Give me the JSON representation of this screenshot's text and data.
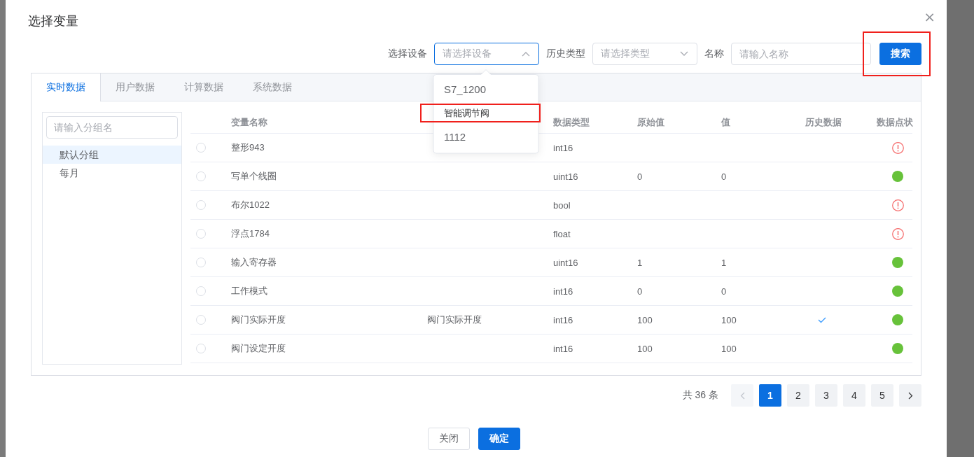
{
  "dialog": {
    "title": "选择变量",
    "close": "×"
  },
  "filters": {
    "device_label": "选择设备",
    "device_select": {
      "placeholder": "请选择设备",
      "expanded": true
    },
    "history_label": "历史类型",
    "history_select": {
      "placeholder": "请选择类型",
      "expanded": false
    },
    "name_label": "名称",
    "name_field": {
      "placeholder": "请输入名称"
    },
    "search_button": {
      "label": "搜索",
      "highlighted": true
    }
  },
  "device_dropdown": {
    "options": [
      {
        "label": "S7_1200",
        "highlighted": false
      },
      {
        "label": "智能调节阀",
        "highlighted": true
      },
      {
        "label": "1112",
        "highlighted": false
      }
    ]
  },
  "tabs": [
    {
      "label": "实时数据",
      "selected": true
    },
    {
      "label": "用户数据",
      "selected": false
    },
    {
      "label": "计算数据",
      "selected": false
    },
    {
      "label": "系统数据",
      "selected": false
    }
  ],
  "groups": {
    "search": {
      "placeholder": "请输入分组名"
    },
    "items": [
      {
        "label": "默认分组",
        "selected": true
      },
      {
        "label": "每月",
        "selected": false
      }
    ]
  },
  "table": {
    "columns": [
      {
        "label": "变量名称"
      },
      {},
      {
        "label": "数据类型"
      },
      {
        "label": "原始值"
      },
      {
        "label": "值"
      },
      {
        "label": "历史数据"
      },
      {
        "label": "数据点状"
      }
    ],
    "rows": [
      {
        "selected": false,
        "name": "整形943",
        "type": "int16",
        "history": false,
        "warning": true
      },
      {
        "selected": false,
        "name": "写单个线圈",
        "type": "uint16",
        "raw": "0",
        "value": "0",
        "history": false,
        "warning": false
      },
      {
        "selected": false,
        "name": "布尔1022",
        "type": "bool",
        "history": false,
        "warning": true
      },
      {
        "selected": false,
        "name": "浮点1784",
        "type": "float",
        "history": false,
        "warning": true
      },
      {
        "selected": false,
        "name": "输入寄存器",
        "type": "uint16",
        "raw": "1",
        "value": "1",
        "history": false,
        "warning": false
      },
      {
        "selected": false,
        "name": "工作模式",
        "type": "int16",
        "raw": "0",
        "value": "0",
        "history": false,
        "warning": false
      },
      {
        "selected": false,
        "name": "阀门实际开度",
        "column_3": "阀门实际开度",
        "type": "int16",
        "raw": "100",
        "value": "100",
        "history": true,
        "warning": false
      },
      {
        "selected": false,
        "name": "阀门设定开度",
        "type": "int16",
        "raw": "100",
        "value": "100",
        "history": false,
        "warning": false
      }
    ]
  },
  "pagination": {
    "total": "共 36 条",
    "prev_disabled": true,
    "pages": [
      {
        "label": "1",
        "selected": true
      },
      {
        "label": "2",
        "selected": false
      },
      {
        "label": "3",
        "selected": false
      },
      {
        "label": "4",
        "selected": false
      },
      {
        "label": "5",
        "selected": false
      }
    ]
  },
  "footer": {
    "buttons": [
      {
        "label": "关闭",
        "kind": "plain"
      },
      {
        "label": "确定",
        "kind": "primary"
      }
    ]
  }
}
